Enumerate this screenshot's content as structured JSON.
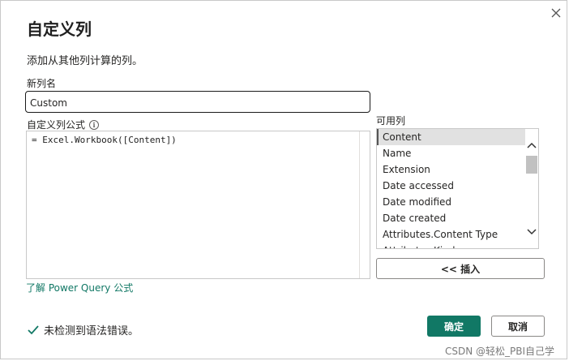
{
  "dialog": {
    "title": "自定义列",
    "description": "添加从其他列计算的列。",
    "close_icon": "close-icon"
  },
  "new_column": {
    "label": "新列名",
    "value": "Custom"
  },
  "formula": {
    "label": "自定义列公式",
    "info_icon": "info-icon",
    "value": "= Excel.Workbook([Content])"
  },
  "available_columns": {
    "label": "可用列",
    "items": [
      "Content",
      "Name",
      "Extension",
      "Date accessed",
      "Date modified",
      "Date created",
      "Attributes.Content Type",
      "Attributes.Kind"
    ],
    "selected": "Content",
    "insert_label": "<< 插入"
  },
  "learn_link": "了解 Power Query 公式",
  "status": {
    "icon": "checkmark-icon",
    "text": "未检测到语法错误。"
  },
  "buttons": {
    "ok": "确定",
    "cancel": "取消"
  },
  "watermark": "CSDN @轻松_PBI自己学",
  "colors": {
    "accent": "#117865",
    "success": "#117865",
    "selected_bg": "#e1e1e1"
  }
}
